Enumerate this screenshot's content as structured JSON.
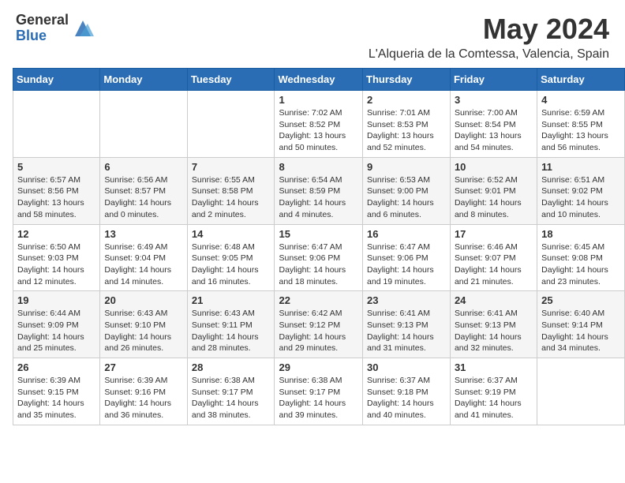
{
  "header": {
    "logo_general": "General",
    "logo_blue": "Blue",
    "title": "May 2024",
    "subtitle": "L'Alqueria de la Comtessa, Valencia, Spain"
  },
  "days_of_week": [
    "Sunday",
    "Monday",
    "Tuesday",
    "Wednesday",
    "Thursday",
    "Friday",
    "Saturday"
  ],
  "weeks": [
    [
      {
        "day": "",
        "info": ""
      },
      {
        "day": "",
        "info": ""
      },
      {
        "day": "",
        "info": ""
      },
      {
        "day": "1",
        "info": "Sunrise: 7:02 AM\nSunset: 8:52 PM\nDaylight: 13 hours\nand 50 minutes."
      },
      {
        "day": "2",
        "info": "Sunrise: 7:01 AM\nSunset: 8:53 PM\nDaylight: 13 hours\nand 52 minutes."
      },
      {
        "day": "3",
        "info": "Sunrise: 7:00 AM\nSunset: 8:54 PM\nDaylight: 13 hours\nand 54 minutes."
      },
      {
        "day": "4",
        "info": "Sunrise: 6:59 AM\nSunset: 8:55 PM\nDaylight: 13 hours\nand 56 minutes."
      }
    ],
    [
      {
        "day": "5",
        "info": "Sunrise: 6:57 AM\nSunset: 8:56 PM\nDaylight: 13 hours\nand 58 minutes."
      },
      {
        "day": "6",
        "info": "Sunrise: 6:56 AM\nSunset: 8:57 PM\nDaylight: 14 hours\nand 0 minutes."
      },
      {
        "day": "7",
        "info": "Sunrise: 6:55 AM\nSunset: 8:58 PM\nDaylight: 14 hours\nand 2 minutes."
      },
      {
        "day": "8",
        "info": "Sunrise: 6:54 AM\nSunset: 8:59 PM\nDaylight: 14 hours\nand 4 minutes."
      },
      {
        "day": "9",
        "info": "Sunrise: 6:53 AM\nSunset: 9:00 PM\nDaylight: 14 hours\nand 6 minutes."
      },
      {
        "day": "10",
        "info": "Sunrise: 6:52 AM\nSunset: 9:01 PM\nDaylight: 14 hours\nand 8 minutes."
      },
      {
        "day": "11",
        "info": "Sunrise: 6:51 AM\nSunset: 9:02 PM\nDaylight: 14 hours\nand 10 minutes."
      }
    ],
    [
      {
        "day": "12",
        "info": "Sunrise: 6:50 AM\nSunset: 9:03 PM\nDaylight: 14 hours\nand 12 minutes."
      },
      {
        "day": "13",
        "info": "Sunrise: 6:49 AM\nSunset: 9:04 PM\nDaylight: 14 hours\nand 14 minutes."
      },
      {
        "day": "14",
        "info": "Sunrise: 6:48 AM\nSunset: 9:05 PM\nDaylight: 14 hours\nand 16 minutes."
      },
      {
        "day": "15",
        "info": "Sunrise: 6:47 AM\nSunset: 9:06 PM\nDaylight: 14 hours\nand 18 minutes."
      },
      {
        "day": "16",
        "info": "Sunrise: 6:47 AM\nSunset: 9:06 PM\nDaylight: 14 hours\nand 19 minutes."
      },
      {
        "day": "17",
        "info": "Sunrise: 6:46 AM\nSunset: 9:07 PM\nDaylight: 14 hours\nand 21 minutes."
      },
      {
        "day": "18",
        "info": "Sunrise: 6:45 AM\nSunset: 9:08 PM\nDaylight: 14 hours\nand 23 minutes."
      }
    ],
    [
      {
        "day": "19",
        "info": "Sunrise: 6:44 AM\nSunset: 9:09 PM\nDaylight: 14 hours\nand 25 minutes."
      },
      {
        "day": "20",
        "info": "Sunrise: 6:43 AM\nSunset: 9:10 PM\nDaylight: 14 hours\nand 26 minutes."
      },
      {
        "day": "21",
        "info": "Sunrise: 6:43 AM\nSunset: 9:11 PM\nDaylight: 14 hours\nand 28 minutes."
      },
      {
        "day": "22",
        "info": "Sunrise: 6:42 AM\nSunset: 9:12 PM\nDaylight: 14 hours\nand 29 minutes."
      },
      {
        "day": "23",
        "info": "Sunrise: 6:41 AM\nSunset: 9:13 PM\nDaylight: 14 hours\nand 31 minutes."
      },
      {
        "day": "24",
        "info": "Sunrise: 6:41 AM\nSunset: 9:13 PM\nDaylight: 14 hours\nand 32 minutes."
      },
      {
        "day": "25",
        "info": "Sunrise: 6:40 AM\nSunset: 9:14 PM\nDaylight: 14 hours\nand 34 minutes."
      }
    ],
    [
      {
        "day": "26",
        "info": "Sunrise: 6:39 AM\nSunset: 9:15 PM\nDaylight: 14 hours\nand 35 minutes."
      },
      {
        "day": "27",
        "info": "Sunrise: 6:39 AM\nSunset: 9:16 PM\nDaylight: 14 hours\nand 36 minutes."
      },
      {
        "day": "28",
        "info": "Sunrise: 6:38 AM\nSunset: 9:17 PM\nDaylight: 14 hours\nand 38 minutes."
      },
      {
        "day": "29",
        "info": "Sunrise: 6:38 AM\nSunset: 9:17 PM\nDaylight: 14 hours\nand 39 minutes."
      },
      {
        "day": "30",
        "info": "Sunrise: 6:37 AM\nSunset: 9:18 PM\nDaylight: 14 hours\nand 40 minutes."
      },
      {
        "day": "31",
        "info": "Sunrise: 6:37 AM\nSunset: 9:19 PM\nDaylight: 14 hours\nand 41 minutes."
      },
      {
        "day": "",
        "info": ""
      }
    ]
  ]
}
